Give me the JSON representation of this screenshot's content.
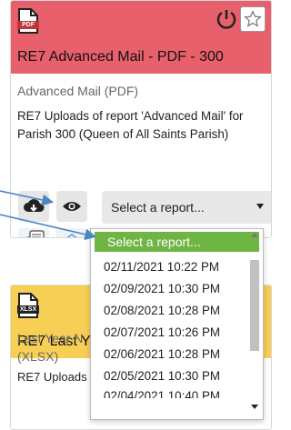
{
  "card1": {
    "file_type": "PDF",
    "title": "RE7 Advanced Mail - PDF - 300",
    "subtitle": "Advanced Mail (PDF)",
    "description": "RE7 Uploads of report 'Advanced Mail' for Parish 300 (Queen of All Saints Parish)",
    "header_color": "#e8606c",
    "icons": [
      "cloud-download-icon",
      "eye-icon",
      "mobile-report-icon",
      "email-icon"
    ],
    "select": {
      "value": "Select a report..."
    }
  },
  "dropdown": {
    "selected": "Select a report...",
    "options": [
      "02/11/2021 10:22 PM",
      "02/09/2021 10:30 PM",
      "02/08/2021 10:28 PM",
      "02/07/2021 10:26 PM",
      "02/06/2021 10:28 PM",
      "02/05/2021 10:30 PM"
    ],
    "highlight_color": "#6fb544"
  },
  "card2": {
    "file_type": "XLSX",
    "title": "RE7 Last Y",
    "subtitle_line1": "Last Year N",
    "subtitle_line2": "(XLSX)",
    "description": "RE7 Uploads",
    "header_color": "#f7cf55"
  }
}
